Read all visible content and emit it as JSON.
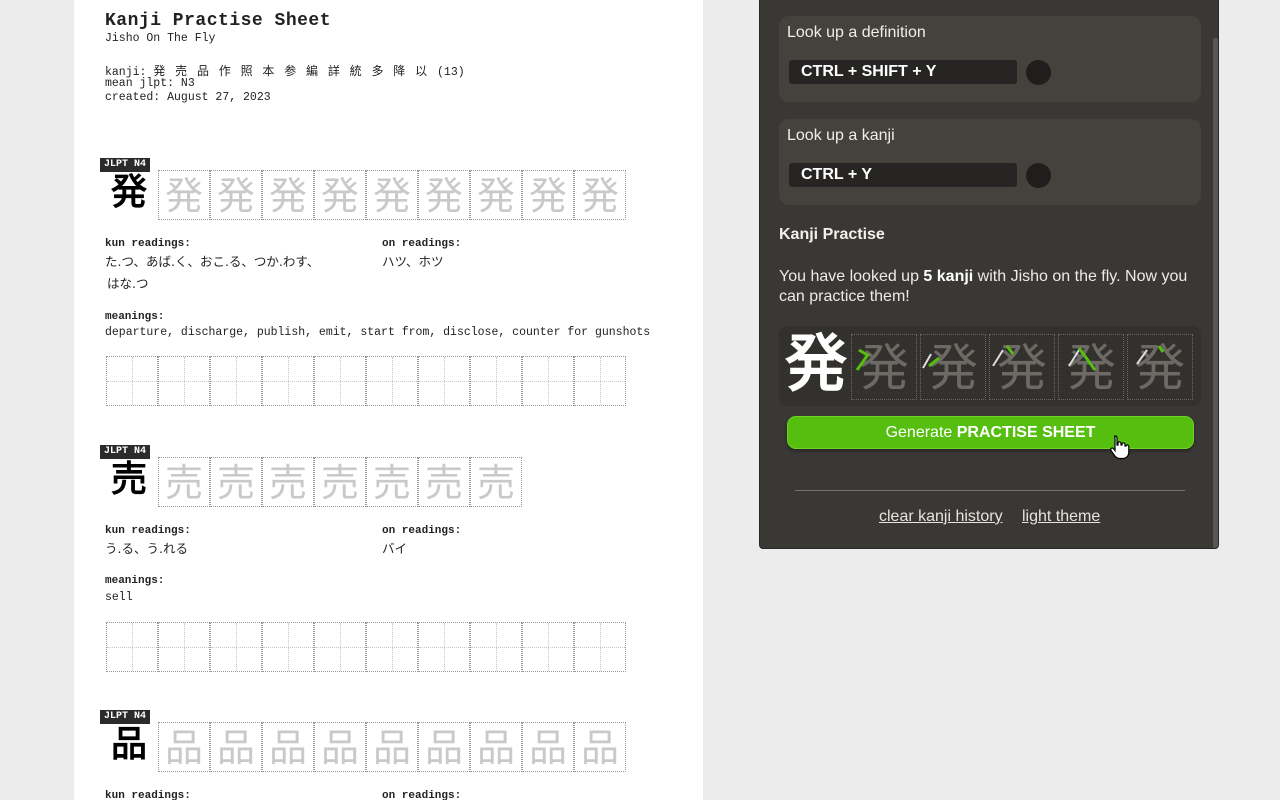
{
  "sheet": {
    "title": "Kanji Practise Sheet",
    "subtitle": "Jisho On The Fly",
    "kanji_label": "kanji:",
    "kanji_list": "発 売 品 作 照 本 参 編 詳 統 多 降 以",
    "kanji_count": "(13)",
    "mean_jlpt": "mean jlpt: N3",
    "created": "created: August 27, 2023",
    "kun_label": "kun readings:",
    "on_label": "on readings:",
    "meanings_label": "meanings:",
    "entries": [
      {
        "badge": "JLPT N4",
        "kanji": "発",
        "kun_line1": "た.つ、あば.く、おこ.る、つか.わす、",
        "kun_line2": "はな.つ",
        "on": "ハツ、ホツ",
        "meanings": "departure, discharge, publish, emit, start from, disclose, counter for gunshots"
      },
      {
        "badge": "JLPT N4",
        "kanji": "売",
        "kun_line1": "う.る、う.れる",
        "kun_line2": "",
        "on": "バイ",
        "meanings": "sell"
      },
      {
        "badge": "JLPT N4",
        "kanji": "品",
        "kun_line1": "",
        "kun_line2": "",
        "on": "",
        "meanings": ""
      }
    ]
  },
  "popup": {
    "definition_title": "Look up a definition",
    "definition_shortcut": "CTRL + SHIFT + Y",
    "kanji_title": "Look up a kanji",
    "kanji_shortcut": "CTRL + Y",
    "practise_heading": "Kanji Practise",
    "para_prefix": "You have looked up ",
    "para_count": "5 kanji",
    "para_suffix": " with Jisho on the fly. Now you can practice them!",
    "demo_kanji": "発",
    "generate_prefix": "Generate ",
    "generate_bold": "PRACTISE SHEET",
    "clear_history": "clear kanji history",
    "light_theme": "light theme",
    "accent_color": "#55be0f"
  }
}
